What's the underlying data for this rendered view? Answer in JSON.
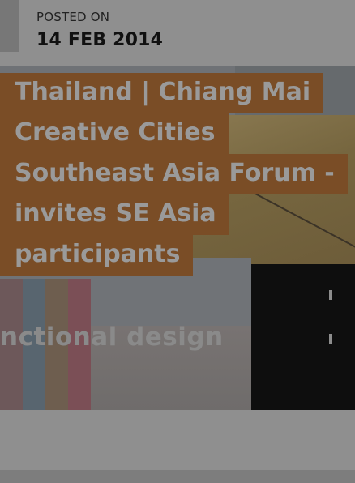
{
  "post": {
    "posted_on_label": "POSTED ON",
    "date": "14 FEB 2014"
  },
  "article": {
    "title_lines": [
      "Thailand | Chiang Mai",
      "Creative Cities",
      "Southeast Asia Forum -",
      "invites SE Asia",
      "participants"
    ],
    "image_caption": "nctional design"
  }
}
